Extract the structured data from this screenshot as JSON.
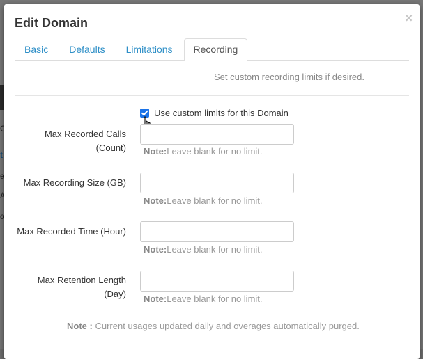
{
  "background": {
    "fragments": [
      "C",
      "t",
      "e",
      "A",
      "o"
    ]
  },
  "modal": {
    "title": "Edit Domain",
    "close_glyph": "×"
  },
  "tabs": [
    {
      "label": "Basic",
      "active": false
    },
    {
      "label": "Defaults",
      "active": false
    },
    {
      "label": "Limitations",
      "active": false
    },
    {
      "label": "Recording",
      "active": true
    }
  ],
  "recording": {
    "hint": "Set custom recording limits if desired.",
    "custom_limits": {
      "label": "Use custom limits for this Domain",
      "checked": true
    },
    "note_prefix": "Note:",
    "note_text": "Leave blank for no limit.",
    "fields": [
      {
        "label_line1": "Max Recorded Calls",
        "label_line2": "(Count)",
        "value": ""
      },
      {
        "label_line1": "Max Recording Size (GB)",
        "label_line2": "",
        "value": ""
      },
      {
        "label_line1": "Max Recorded Time (Hour)",
        "label_line2": "",
        "value": ""
      },
      {
        "label_line1": "Max Retention Length",
        "label_line2": "(Day)",
        "value": ""
      }
    ],
    "footer_prefix": "Note :",
    "footer_text": " Current usages updated daily and overages automatically purged."
  },
  "colors": {
    "tab_link": "#2e8fc7",
    "checkbox": "#1a73e8"
  },
  "icons": [
    "close-icon",
    "checkmark-icon",
    "hand-pointer-cursor-icon"
  ]
}
